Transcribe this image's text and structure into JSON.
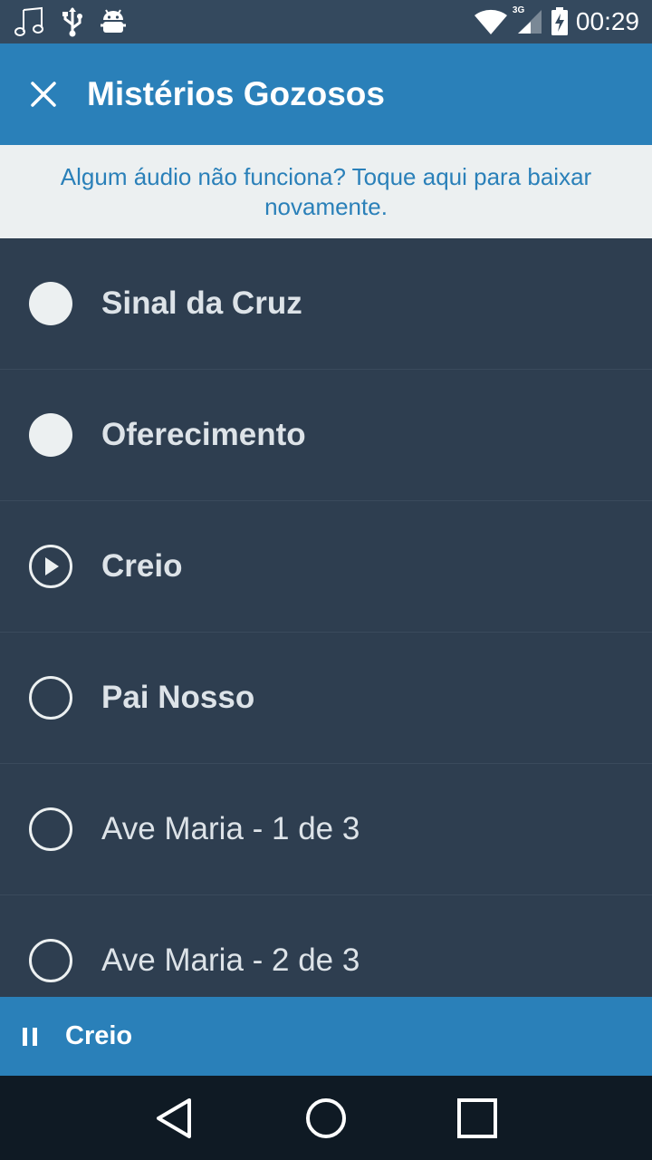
{
  "status_bar": {
    "time": "00:29",
    "network": "3G",
    "icons": [
      "music-note-icon",
      "usb-icon",
      "android-debug-icon",
      "wifi-icon",
      "cell-signal-icon",
      "battery-charging-icon"
    ]
  },
  "app_bar": {
    "title": "Mistérios Gozosos",
    "close_icon": "close-icon"
  },
  "banner": {
    "text": "Algum áudio não funciona? Toque aqui para baixar novamente."
  },
  "prayers": [
    {
      "label": "Sinal da Cruz",
      "state": "completed"
    },
    {
      "label": "Oferecimento",
      "state": "completed"
    },
    {
      "label": "Creio",
      "state": "playing"
    },
    {
      "label": "Pai Nosso",
      "state": "pending"
    },
    {
      "label": "Ave Maria - 1 de 3",
      "state": "pending"
    },
    {
      "label": "Ave Maria - 2 de 3",
      "state": "pending"
    }
  ],
  "player": {
    "now_playing": "Creio",
    "control_icon": "pause-icon"
  },
  "nav_bar": {
    "buttons": [
      "back-icon",
      "home-icon",
      "recents-icon"
    ]
  },
  "colors": {
    "status_bar": "#34495e",
    "app_bar": "#2a80b9",
    "banner_bg": "#ecf0f1",
    "list_bg": "#2e3e50",
    "nav_bar": "#0f1a24"
  }
}
